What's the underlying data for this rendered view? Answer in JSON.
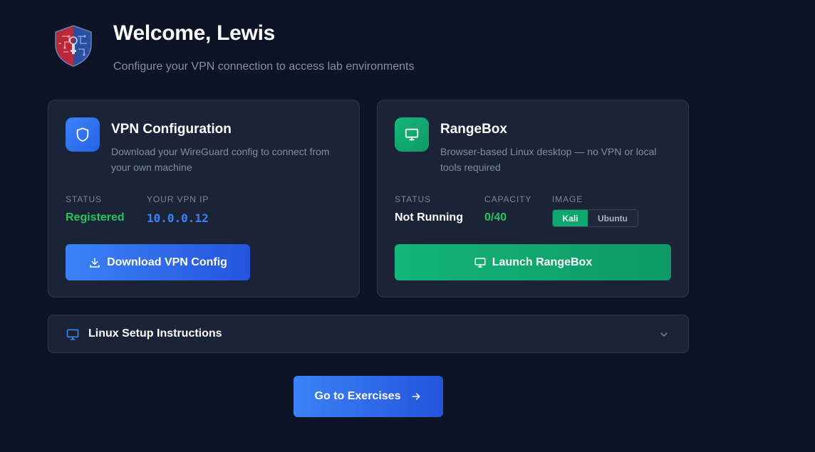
{
  "header": {
    "welcome": "Welcome, Lewis",
    "subtitle": "Configure your VPN connection to access lab environments"
  },
  "vpn_card": {
    "title": "VPN Configuration",
    "description": "Download your WireGuard config to connect from your own machine",
    "status_label": "STATUS",
    "status_value": "Registered",
    "ip_label": "YOUR VPN IP",
    "ip_value": "10.0.0.12",
    "button_label": "Download VPN Config",
    "icon": "shield-icon"
  },
  "range_card": {
    "title": "RangeBox",
    "description": "Browser-based Linux desktop — no VPN or local tools required",
    "status_label": "STATUS",
    "status_value": "Not Running",
    "capacity_label": "CAPACITY",
    "capacity_value": "0/40",
    "image_label": "IMAGE",
    "image_options": [
      "Kali",
      "Ubuntu"
    ],
    "image_selected": "Kali",
    "button_label": "Launch RangeBox",
    "icon": "monitor-icon"
  },
  "accordion": {
    "title": "Linux Setup Instructions",
    "icon": "monitor-icon",
    "expanded": false
  },
  "cta": {
    "label": "Go to Exercises"
  },
  "colors": {
    "background": "#0c1425",
    "card": "#1a2436",
    "accent_blue": "#3b82f6",
    "accent_green": "#10a66f",
    "success_text": "#22c55e"
  }
}
